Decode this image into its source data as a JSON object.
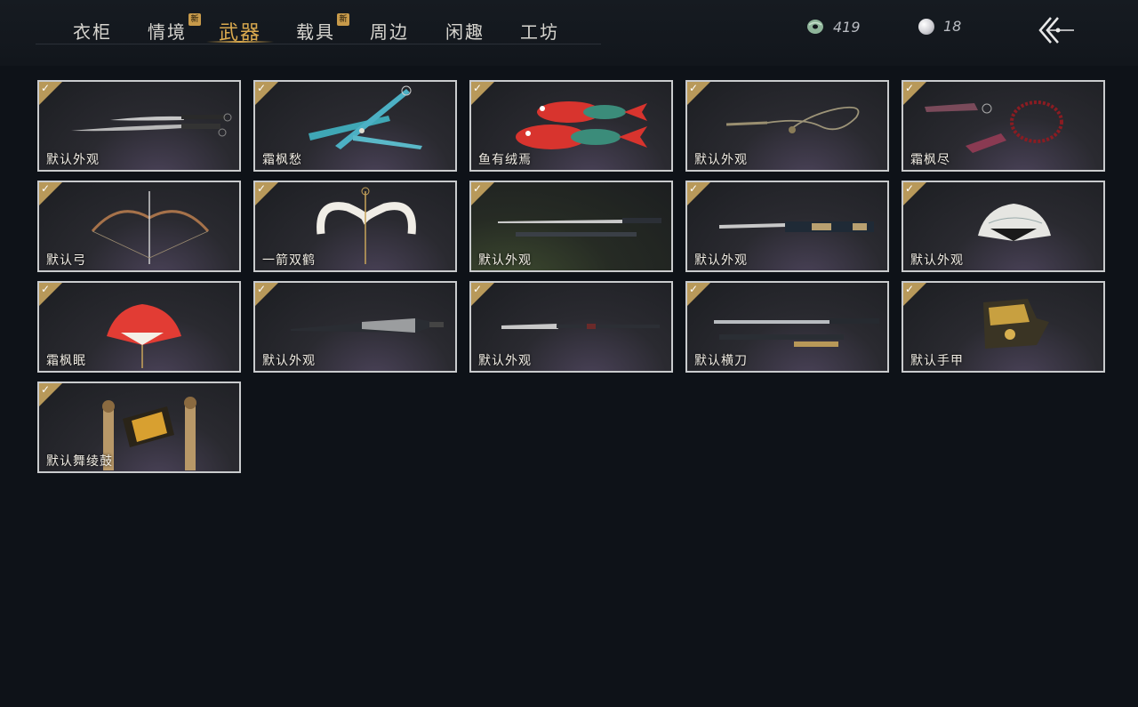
{
  "tabs": [
    {
      "label": "衣柜",
      "new": false,
      "active": false
    },
    {
      "label": "情境",
      "new": true,
      "active": false
    },
    {
      "label": "武器",
      "new": false,
      "active": true
    },
    {
      "label": "载具",
      "new": true,
      "active": false
    },
    {
      "label": "周边",
      "new": false,
      "active": false
    },
    {
      "label": "闲趣",
      "new": false,
      "active": false
    },
    {
      "label": "工坊",
      "new": false,
      "active": false
    }
  ],
  "new_badge": "新",
  "currency": {
    "jade": {
      "value": "419",
      "icon": "jade-coin-icon"
    },
    "pearl": {
      "value": "18",
      "icon": "pearl-icon"
    }
  },
  "back_icon": "back-arrow-icon",
  "check_mark": "✓",
  "items": [
    {
      "label": "默认外观",
      "art": "twin-sabres",
      "equipped": true
    },
    {
      "label": "霜枫愁",
      "art": "teal-blades",
      "equipped": true
    },
    {
      "label": "鱼有绒焉",
      "art": "red-fish",
      "equipped": true
    },
    {
      "label": "默认外观",
      "art": "rope-dart",
      "equipped": true
    },
    {
      "label": "霜枫尽",
      "art": "bead-dart",
      "equipped": true
    },
    {
      "label": "默认弓",
      "art": "bow",
      "equipped": true
    },
    {
      "label": "一箭双鹤",
      "art": "white-bow",
      "equipped": true
    },
    {
      "label": "默认外观",
      "art": "long-sword",
      "equipped": true
    },
    {
      "label": "默认外观",
      "art": "ornate-sword",
      "equipped": true
    },
    {
      "label": "默认外观",
      "art": "white-fan",
      "equipped": true
    },
    {
      "label": "霜枫眠",
      "art": "red-fan",
      "equipped": true
    },
    {
      "label": "默认外观",
      "art": "umbrella",
      "equipped": true
    },
    {
      "label": "默认外观",
      "art": "spear",
      "equipped": true
    },
    {
      "label": "默认横刀",
      "art": "hengdao",
      "equipped": true
    },
    {
      "label": "默认手甲",
      "art": "gauntlet",
      "equipped": true
    },
    {
      "label": "默认舞绫鼓",
      "art": "drum",
      "equipped": true
    }
  ]
}
